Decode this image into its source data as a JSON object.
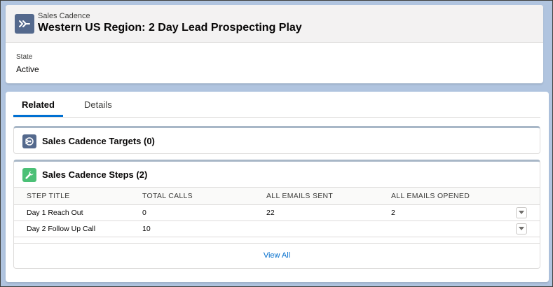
{
  "header": {
    "object_label": "Sales Cadence",
    "title": "Western US Region: 2 Day Lead Prospecting Play",
    "icon": "arrow-forward-icon",
    "icon_color": "#54698d",
    "fields": [
      {
        "label": "State",
        "value": "Active"
      }
    ]
  },
  "tabs": [
    {
      "label": "Related",
      "active": true
    },
    {
      "label": "Details",
      "active": false
    }
  ],
  "targets_card": {
    "title": "Sales Cadence Targets (0)",
    "icon": "target-icon",
    "icon_color": "#54698d"
  },
  "steps_card": {
    "title": "Sales Cadence Steps (2)",
    "icon": "wrench-icon",
    "icon_color": "#4bc076",
    "columns": [
      "STEP TITLE",
      "TOTAL CALLS",
      "ALL EMAILS SENT",
      "ALL EMAILS OPENED"
    ],
    "rows": [
      {
        "step_title": "Day 1 Reach Out",
        "total_calls": "0",
        "emails_sent": "22",
        "emails_opened": "2"
      },
      {
        "step_title": "Day 2 Follow Up Call",
        "total_calls": "10",
        "emails_sent": "",
        "emails_opened": ""
      }
    ],
    "view_all": "View All"
  },
  "colors": {
    "accent": "#0070d2",
    "link": "#006dcc",
    "background": "#b0c4df"
  }
}
